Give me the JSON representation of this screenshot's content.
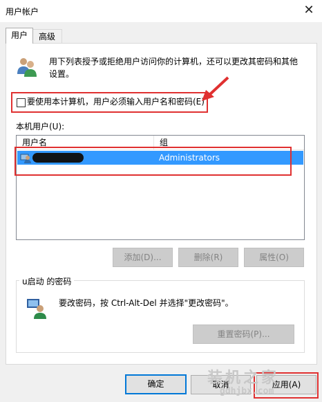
{
  "window": {
    "title": "用户帐户",
    "close_icon": "close-icon"
  },
  "tabs": [
    {
      "label": "用户",
      "active": true
    },
    {
      "label": "高级",
      "active": false
    }
  ],
  "description": {
    "line1": "用下列表授予或拒绝用户访问你的计算机，还可以更改其密码和其他",
    "line2": "设置。",
    "icon": "users-icon"
  },
  "require_login": {
    "label": "要使用本计算机，用户必须输入用户名和密码(E)",
    "checked": false
  },
  "local_users": {
    "label": "本机用户(U):",
    "columns": [
      "用户名",
      "组"
    ],
    "rows": [
      {
        "username": "",
        "group": "Administrators",
        "selected": true
      }
    ]
  },
  "user_buttons": [
    {
      "label": "添加(D)...",
      "enabled": false
    },
    {
      "label": "删除(R)",
      "enabled": false
    },
    {
      "label": "属性(O)",
      "enabled": false
    }
  ],
  "password_group": {
    "title": "u启动 的密码",
    "text": "要改密码，按 Ctrl-Alt-Del 并选择\"更改密码\"。",
    "reset_label": "重置密码(P)...",
    "icon": "password-user-icon"
  },
  "footer": {
    "ok": "确定",
    "cancel": "取消",
    "apply": "应用(A)"
  },
  "watermark": {
    "line1": "装机之家",
    "line2": "gdhjbx.com"
  },
  "colors": {
    "selection": "#3399ff",
    "annotation": "#e03030",
    "default_button": "#0078d7"
  }
}
